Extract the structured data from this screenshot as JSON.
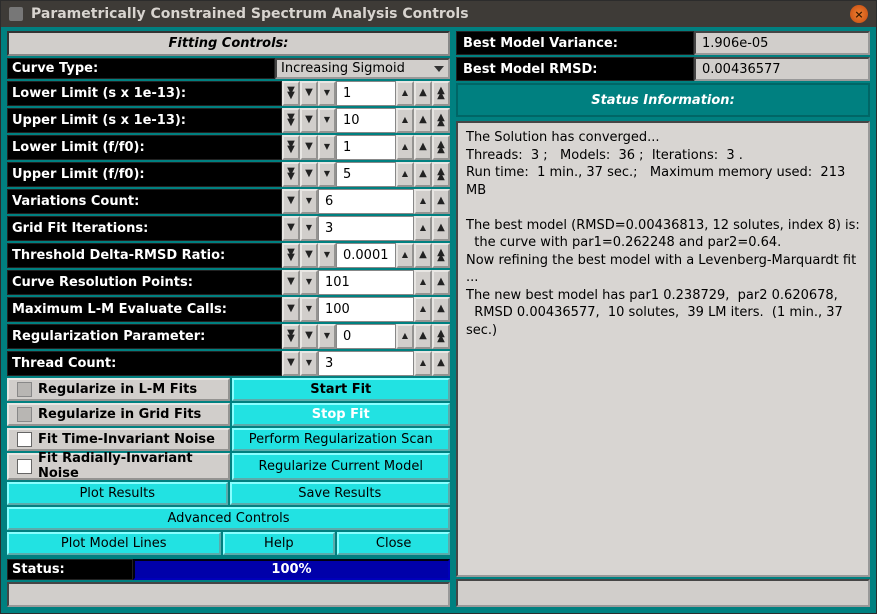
{
  "window": {
    "title": "Parametrically Constrained Spectrum Analysis Controls"
  },
  "left": {
    "header": "Fitting Controls:",
    "curve_type": {
      "label": "Curve Type:",
      "value": "Increasing Sigmoid"
    },
    "params": [
      {
        "label": "Lower Limit (s x 1e-13):",
        "value": "1",
        "big_left": true,
        "big_right": true
      },
      {
        "label": "Upper Limit (s x 1e-13):",
        "value": "10",
        "big_left": true,
        "big_right": true
      },
      {
        "label": "Lower Limit (f/f0):",
        "value": "1",
        "big_left": true,
        "big_right": true
      },
      {
        "label": "Upper Limit (f/f0):",
        "value": "5",
        "big_left": true,
        "big_right": true
      },
      {
        "label": "Variations Count:",
        "value": "6",
        "big_left": false,
        "big_right": false
      },
      {
        "label": "Grid Fit Iterations:",
        "value": "3",
        "big_left": false,
        "big_right": false
      },
      {
        "label": "Threshold Delta-RMSD Ratio:",
        "value": "0.0001",
        "big_left": true,
        "big_right": true
      },
      {
        "label": "Curve Resolution Points:",
        "value": "101",
        "big_left": false,
        "big_right": false
      },
      {
        "label": "Maximum L-M Evaluate Calls:",
        "value": "100",
        "big_left": false,
        "big_right": false
      },
      {
        "label": "Regularization Parameter:",
        "value": "0",
        "big_left": true,
        "big_right": true
      },
      {
        "label": "Thread Count:",
        "value": "3",
        "big_left": false,
        "big_right": false
      }
    ],
    "check1": "Regularize in L-M Fits",
    "check2": "Regularize in Grid Fits",
    "check3": "Fit Time-Invariant Noise",
    "check4": "Fit Radially-Invariant Noise",
    "start_fit": "Start Fit",
    "stop_fit": "Stop Fit",
    "perform_reg": "Perform Regularization Scan",
    "reg_current": "Regularize Current Model",
    "plot_results": "Plot Results",
    "save_results": "Save Results",
    "advanced": "Advanced Controls",
    "plot_model_lines": "Plot Model Lines",
    "help": "Help",
    "close": "Close",
    "status_label": "Status:",
    "status_pct": "100%"
  },
  "right": {
    "metric1_label": "Best Model Variance:",
    "metric1_value": "1.906e-05",
    "metric2_label": "Best Model RMSD:",
    "metric2_value": "0.00436577",
    "status_header": "Status Information:",
    "info_text": "The Solution has converged...\nThreads:  3 ;   Models:  36 ;  Iterations:  3 .\nRun time:  1 min., 37 sec.;   Maximum memory used:  213 MB\n\nThe best model (RMSD=0.00436813, 12 solutes, index 8) is:\n  the curve with par1=0.262248 and par2=0.64.\nNow refining the best model with a Levenberg-Marquardt fit ...\nThe new best model has par1 0.238729,  par2 0.620678,\n  RMSD 0.00436577,  10 solutes,  39 LM iters.  (1 min., 37 sec.)"
  }
}
